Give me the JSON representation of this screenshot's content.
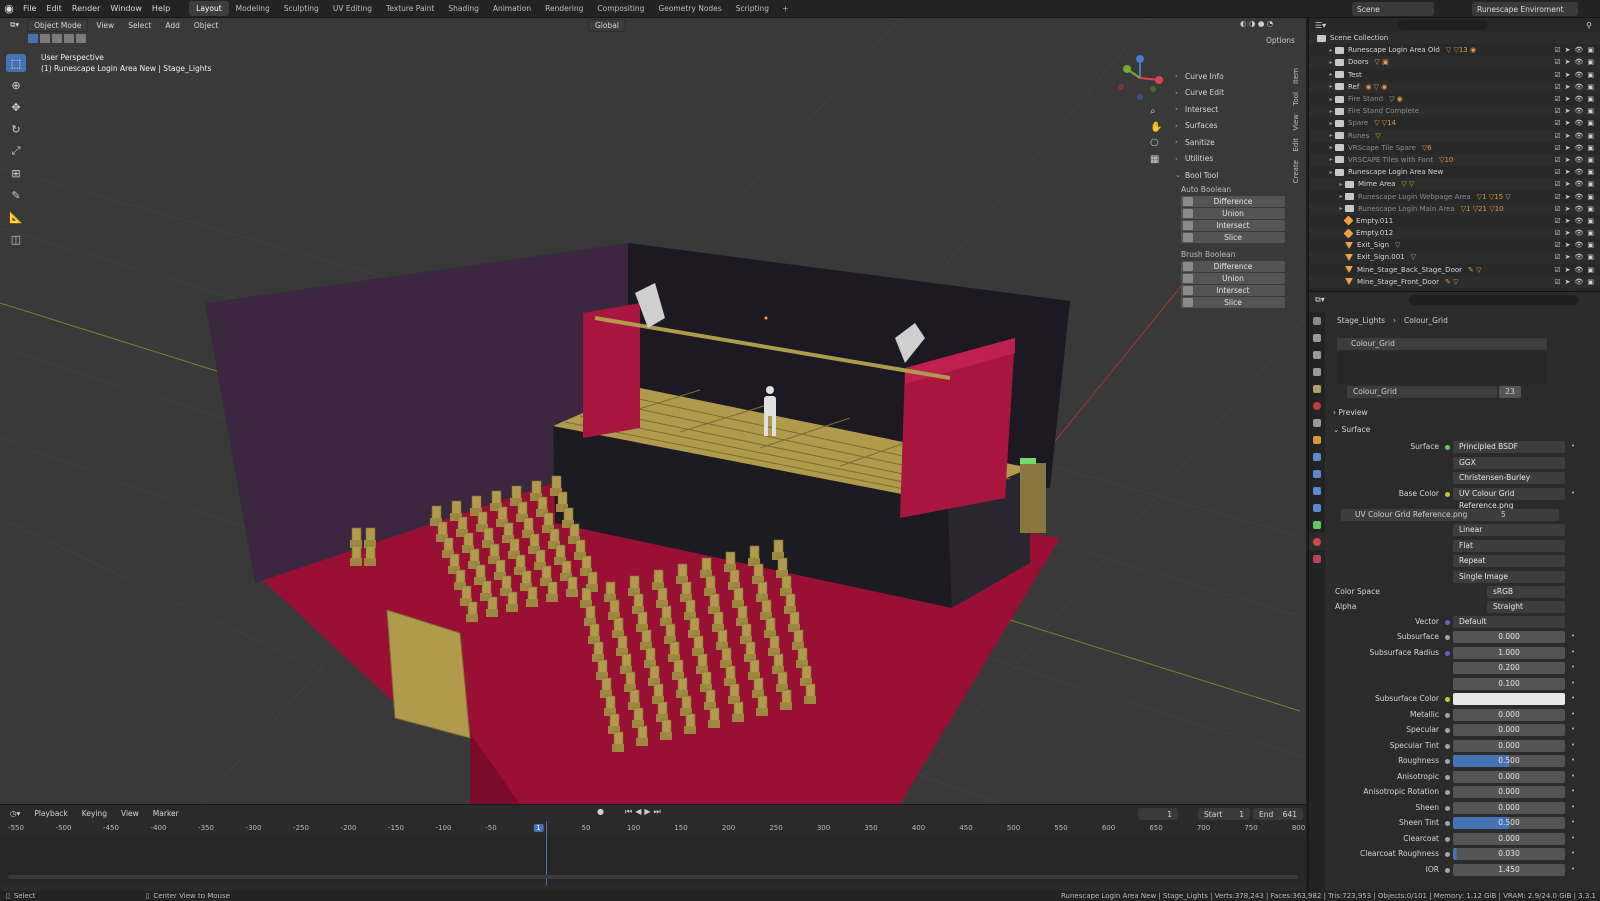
{
  "menu": [
    "File",
    "Edit",
    "Render",
    "Window",
    "Help"
  ],
  "workspaces": [
    "Layout",
    "Modeling",
    "Sculpting",
    "UV Editing",
    "Texture Paint",
    "Shading",
    "Animation",
    "Rendering",
    "Compositing",
    "Geometry Nodes",
    "Scripting"
  ],
  "scene_name": "Scene",
  "view_layer": "Runescape Enviroment",
  "viewport": {
    "mode": "Object Mode",
    "menus": [
      "View",
      "Select",
      "Add",
      "Object"
    ],
    "transform": "Global",
    "options": "Options",
    "perspective": "User Perspective",
    "collection_info": "(1) Runescape Login Area New | Stage_Lights"
  },
  "npanel": {
    "items": [
      "Curve Info",
      "Curve Edit",
      "Intersect",
      "Surfaces",
      "Sanitize",
      "Utilities"
    ],
    "bool_tool": "Bool Tool",
    "auto_boolean": "Auto Boolean",
    "brush_boolean": "Brush Boolean",
    "ops": [
      "Difference",
      "Union",
      "Intersect",
      "Slice"
    ],
    "tabs": [
      "Item",
      "Tool",
      "View",
      "Edit",
      "Create"
    ]
  },
  "timeline": {
    "menus": [
      "Playback",
      "Keying",
      "View",
      "Marker"
    ],
    "current_frame": "1",
    "start_label": "Start",
    "start": "1",
    "end_label": "End",
    "end": "641",
    "ticks": [
      "-550",
      "-500",
      "-450",
      "-400",
      "-350",
      "-300",
      "-250",
      "-200",
      "-150",
      "-100",
      "-50",
      "1",
      "50",
      "100",
      "150",
      "200",
      "250",
      "300",
      "350",
      "400",
      "450",
      "500",
      "550",
      "600",
      "650",
      "700",
      "750",
      "800"
    ]
  },
  "statusbar": {
    "left": "Select",
    "mid": "Center View to Mouse",
    "right": "Runescape Login Area New | Stage_Lights | Verts:378,243 | Faces:363,982 | Tris:723,953 | Objects:0/101 | Memory: 1.12 GiB | VRAM: 2.9/24.0 GiB | 3.3.1"
  },
  "outliner": {
    "root": "Scene Collection",
    "rows": [
      {
        "name": "Runescape Login Area Old",
        "type": "col",
        "dim": false,
        "extra": "▽ ▽13 ◉",
        "indent": 1
      },
      {
        "name": "Doors",
        "type": "col",
        "dim": false,
        "extra": "▽ ▣",
        "indent": 1
      },
      {
        "name": "Test",
        "type": "col",
        "dim": false,
        "extra": "",
        "indent": 1
      },
      {
        "name": "Ref",
        "type": "col",
        "dim": false,
        "extra": "◉ ▽ ◉",
        "indent": 1
      },
      {
        "name": "Fire Stand",
        "type": "col",
        "dim": true,
        "extra": "▽ ◉",
        "indent": 1
      },
      {
        "name": "Fire Stand Complete",
        "type": "col",
        "dim": true,
        "extra": "",
        "indent": 1
      },
      {
        "name": "Spare",
        "type": "col",
        "dim": true,
        "extra": "▽ ▽14",
        "indent": 1
      },
      {
        "name": "Runes",
        "type": "col",
        "dim": true,
        "extra": "▽",
        "indent": 1
      },
      {
        "name": "VRScape Tile Spare",
        "type": "col",
        "dim": true,
        "extra": "▽6",
        "indent": 1
      },
      {
        "name": "VRSCAPE Tiles with Font",
        "type": "col",
        "dim": true,
        "extra": "▽10",
        "indent": 1
      },
      {
        "name": "Runescape Login Area New",
        "type": "col",
        "dim": false,
        "extra": "",
        "indent": 1
      },
      {
        "name": "Mime Area",
        "type": "col",
        "dim": false,
        "extra": "▽ ▽",
        "indent": 2
      },
      {
        "name": "Runescape Login Webpage Area",
        "type": "col",
        "dim": true,
        "extra": "▽1 ▽15 ▽",
        "indent": 2
      },
      {
        "name": "Runescape Login Main Area",
        "type": "col",
        "dim": true,
        "extra": "▽1 ▽21 ▽10",
        "indent": 2
      },
      {
        "name": "Empty.011",
        "type": "empty",
        "dim": false,
        "extra": "",
        "indent": 2
      },
      {
        "name": "Empty.012",
        "type": "empty",
        "dim": false,
        "extra": "",
        "indent": 2
      },
      {
        "name": "Exit_Sign",
        "type": "mesh",
        "dim": false,
        "extra": "▽",
        "indent": 2
      },
      {
        "name": "Exit_Sign.001",
        "type": "mesh",
        "dim": false,
        "extra": "▽",
        "indent": 2
      },
      {
        "name": "Mine_Stage_Back_Stage_Door",
        "type": "mesh",
        "dim": false,
        "extra": "✎ ▽",
        "indent": 2
      },
      {
        "name": "Mine_Stage_Front_Door",
        "type": "mesh",
        "dim": false,
        "extra": "✎ ▽",
        "indent": 2
      }
    ]
  },
  "properties": {
    "breadcrumb": [
      "Stage_Lights",
      "Colour_Grid"
    ],
    "slot": "Colour_Grid",
    "material_name": "Colour_Grid",
    "users": "23",
    "preview": "Preview",
    "surface_section": "Surface",
    "fields": [
      {
        "label": "Surface",
        "value": "Principled BSDF",
        "dot": "g",
        "style": "sel"
      },
      {
        "label": "",
        "value": "GGX",
        "dot": "",
        "style": "sel"
      },
      {
        "label": "",
        "value": "Christensen-Burley",
        "dot": "",
        "style": "sel"
      },
      {
        "label": "Base Color",
        "value": "UV Colour Grid Reference.png",
        "dot": "y",
        "style": "sel"
      }
    ],
    "image_block": "UV Colour Grid Reference.png",
    "image_users": "5",
    "image_opts": [
      "Linear",
      "Flat",
      "Repeat",
      "Single Image"
    ],
    "color_space_label": "Color Space",
    "color_space": "sRGB",
    "alpha_label": "Alpha",
    "alpha": "Straight",
    "vector_label": "Vector",
    "vector": "Default",
    "numeric": [
      {
        "label": "Subsurface",
        "value": "0.000",
        "style": "num",
        "dot": ""
      },
      {
        "label": "Subsurface Radius",
        "value": "1.000",
        "style": "num",
        "dot": "b"
      },
      {
        "label": "",
        "value": "0.200",
        "style": "num",
        "dot": "none"
      },
      {
        "label": "",
        "value": "0.100",
        "style": "num",
        "dot": "none"
      },
      {
        "label": "Subsurface Color",
        "value": "",
        "style": "white",
        "dot": "y"
      },
      {
        "label": "Metallic",
        "value": "0.000",
        "style": "num",
        "dot": ""
      },
      {
        "label": "Specular",
        "value": "0.000",
        "style": "num",
        "dot": ""
      },
      {
        "label": "Specular Tint",
        "value": "0.000",
        "style": "num",
        "dot": ""
      },
      {
        "label": "Roughness",
        "value": "0.500",
        "style": "blue",
        "dot": ""
      },
      {
        "label": "Anisotropic",
        "value": "0.000",
        "style": "num",
        "dot": ""
      },
      {
        "label": "Anisotropic Rotation",
        "value": "0.000",
        "style": "num",
        "dot": ""
      },
      {
        "label": "Sheen",
        "value": "0.000",
        "style": "num",
        "dot": ""
      },
      {
        "label": "Sheen Tint",
        "value": "0.500",
        "style": "blue",
        "dot": ""
      },
      {
        "label": "Clearcoat",
        "value": "0.000",
        "style": "num",
        "dot": ""
      },
      {
        "label": "Clearcoat Roughness",
        "value": "0.030",
        "style": "min",
        "dot": ""
      },
      {
        "label": "IOR",
        "value": "1.450",
        "style": "num",
        "dot": ""
      }
    ]
  },
  "colors": {
    "accent": "#4772b3",
    "curtain": "#a8163f",
    "floor": "#9a1035",
    "wood": "#b09a4c",
    "wall": "#3b2840",
    "stage_back": "#1c1922"
  }
}
